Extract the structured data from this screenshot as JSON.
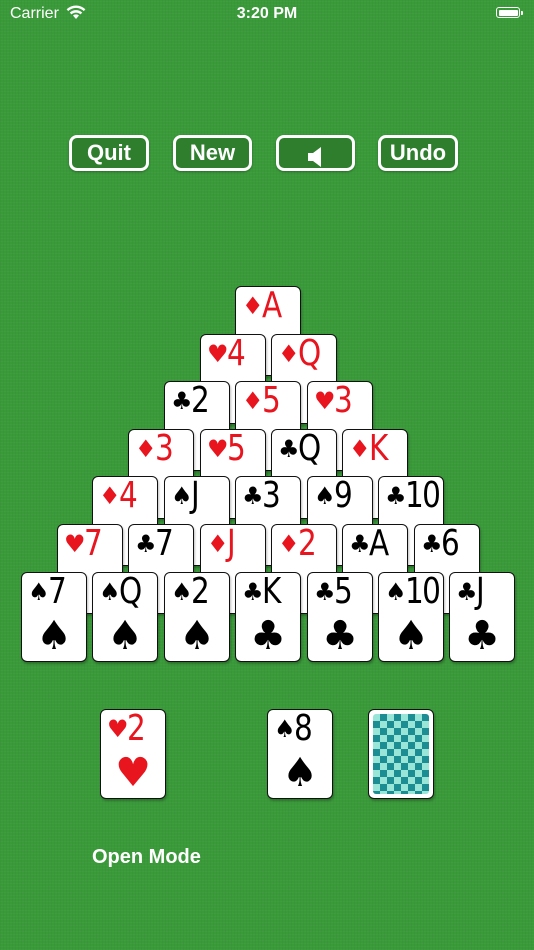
{
  "status_bar": {
    "carrier": "Carrier",
    "time": "3:20 PM"
  },
  "toolbar": {
    "quit_label": "Quit",
    "new_label": "New",
    "undo_label": "Undo",
    "sound_icon": "speaker-icon"
  },
  "suit_symbols": {
    "spade": "♠",
    "heart": "♥",
    "diamond": "♦",
    "club": "♣"
  },
  "suit_colors": {
    "red": "#e8141e",
    "black": "#000000"
  },
  "pyramid": [
    [
      {
        "rank": "A",
        "suit": "diamond"
      }
    ],
    [
      {
        "rank": "4",
        "suit": "heart"
      },
      {
        "rank": "Q",
        "suit": "diamond"
      }
    ],
    [
      {
        "rank": "2",
        "suit": "club"
      },
      {
        "rank": "5",
        "suit": "diamond"
      },
      {
        "rank": "3",
        "suit": "heart"
      }
    ],
    [
      {
        "rank": "3",
        "suit": "diamond"
      },
      {
        "rank": "5",
        "suit": "heart"
      },
      {
        "rank": "Q",
        "suit": "club"
      },
      {
        "rank": "K",
        "suit": "diamond"
      }
    ],
    [
      {
        "rank": "4",
        "suit": "diamond"
      },
      {
        "rank": "J",
        "suit": "spade"
      },
      {
        "rank": "3",
        "suit": "club"
      },
      {
        "rank": "9",
        "suit": "spade"
      },
      {
        "rank": "10",
        "suit": "club"
      }
    ],
    [
      {
        "rank": "7",
        "suit": "heart"
      },
      {
        "rank": "7",
        "suit": "club"
      },
      {
        "rank": "J",
        "suit": "diamond"
      },
      {
        "rank": "2",
        "suit": "diamond"
      },
      {
        "rank": "A",
        "suit": "club"
      },
      {
        "rank": "6",
        "suit": "club"
      }
    ],
    [
      {
        "rank": "7",
        "suit": "spade"
      },
      {
        "rank": "Q",
        "suit": "spade"
      },
      {
        "rank": "2",
        "suit": "spade"
      },
      {
        "rank": "K",
        "suit": "club"
      },
      {
        "rank": "5",
        "suit": "club"
      },
      {
        "rank": "10",
        "suit": "spade"
      },
      {
        "rank": "J",
        "suit": "club"
      }
    ]
  ],
  "foundation_card": {
    "rank": "2",
    "suit": "heart"
  },
  "waste_card": {
    "rank": "8",
    "suit": "spade"
  },
  "mode_label": "Open Mode"
}
